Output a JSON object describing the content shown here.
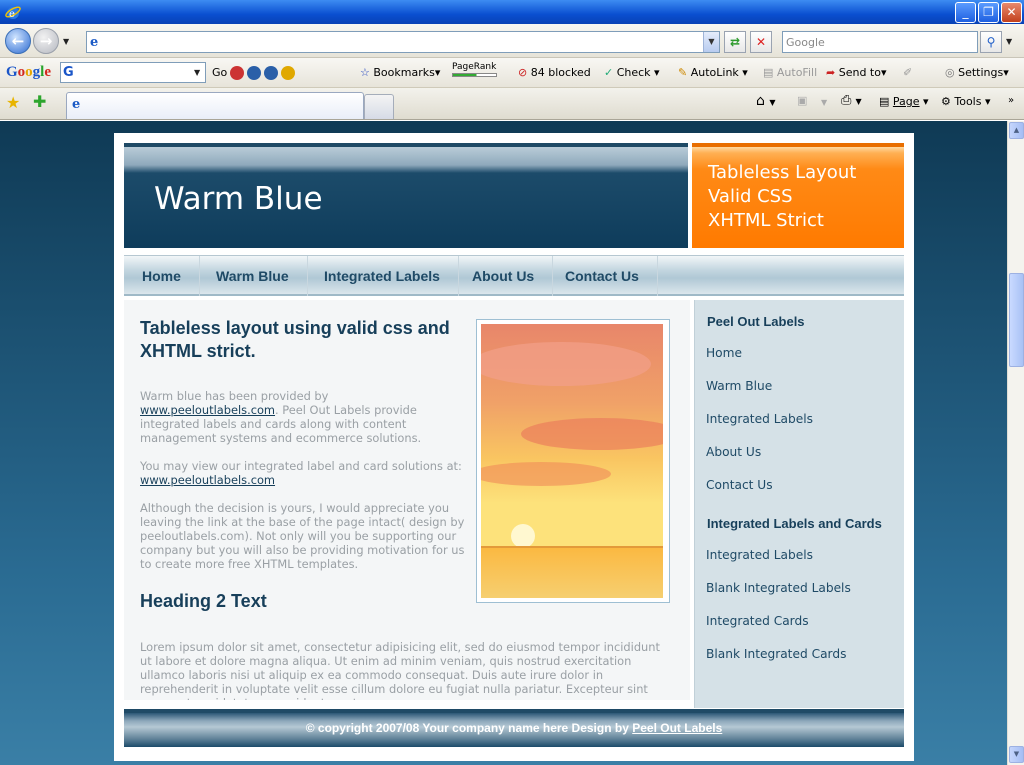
{
  "browser": {
    "search_placeholder": "Google",
    "google_toolbar": {
      "go": "Go",
      "bookmarks": "Bookmarks",
      "pagerank": "PageRank",
      "blocked": "84 blocked",
      "check": "Check",
      "autolink": "AutoLink",
      "autofill": "AutoFill",
      "send_to": "Send to",
      "settings": "Settings"
    },
    "commands": {
      "page": "Page",
      "tools": "Tools"
    }
  },
  "site": {
    "title": "Warm Blue",
    "promo": [
      "Tableless Layout",
      "Valid CSS",
      "XHTML Strict"
    ],
    "nav": [
      "Home",
      "Warm Blue",
      "Integrated Labels",
      "About Us",
      "Contact Us"
    ],
    "main": {
      "heading": "Tableless layout using valid css and XHTML strict.",
      "p1_text": "Warm blue has been provided by ",
      "p1_link": "www.peeloutlabels.com",
      "p1_rest": ". Peel Out Labels provide integrated labels and cards along with content management systems and ecommerce solutions.",
      "p2_text": "You may view our integrated label and card solutions at:",
      "p2_link": "www.peeloutlabels.com",
      "p3": "Although the decision is yours, I would appreciate you leaving the link at the base of the page intact( design by peeloutlabels.com). Not only will you be supporting our company but you will also be providing motivation for us to create more free XHTML templates.",
      "heading2": "Heading 2 Text",
      "lorem": "Lorem ipsum dolor sit amet, consectetur adipisicing elit, sed do eiusmod tempor incididunt ut labore et dolore magna aliqua. Ut enim ad minim veniam, quis nostrud exercitation ullamco laboris nisi ut aliquip ex ea commodo consequat. Duis aute irure dolor in reprehenderit in voluptate velit esse cillum dolore eu fugiat nulla pariatur. Excepteur sint occaecat cupidatat non proident, sunt"
    },
    "sidebar": {
      "heading1": "Peel Out Labels",
      "links1": [
        "Home",
        "Warm Blue",
        "Integrated Labels",
        "About Us",
        "Contact Us"
      ],
      "heading2": "Integrated Labels and Cards",
      "links2": [
        "Integrated Labels",
        "Blank Integrated Labels",
        "Integrated Cards",
        "Blank Integrated Cards"
      ]
    },
    "footer": {
      "text": "© copyright 2007/08 Your company name here Design by ",
      "link": "Peel Out Labels"
    }
  }
}
